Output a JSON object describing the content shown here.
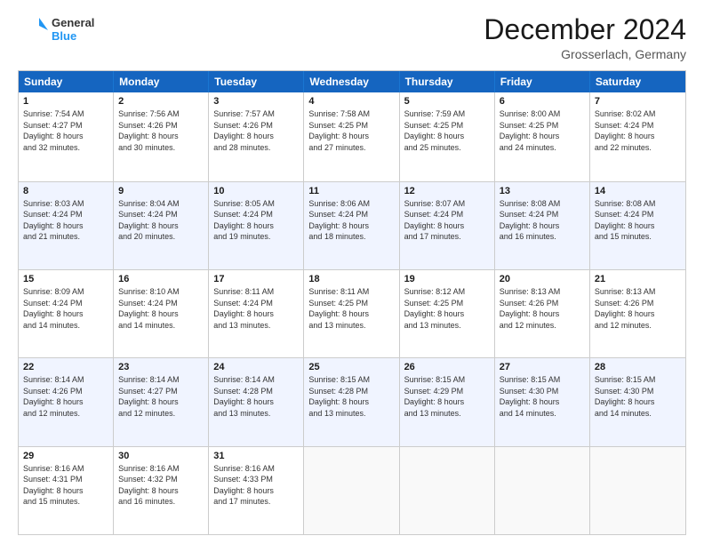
{
  "header": {
    "logo_general": "General",
    "logo_blue": "Blue",
    "month_title": "December 2024",
    "location": "Grosserlach, Germany"
  },
  "weekdays": [
    "Sunday",
    "Monday",
    "Tuesday",
    "Wednesday",
    "Thursday",
    "Friday",
    "Saturday"
  ],
  "rows": [
    [
      {
        "day": "1",
        "lines": [
          "Sunrise: 7:54 AM",
          "Sunset: 4:27 PM",
          "Daylight: 8 hours",
          "and 32 minutes."
        ]
      },
      {
        "day": "2",
        "lines": [
          "Sunrise: 7:56 AM",
          "Sunset: 4:26 PM",
          "Daylight: 8 hours",
          "and 30 minutes."
        ]
      },
      {
        "day": "3",
        "lines": [
          "Sunrise: 7:57 AM",
          "Sunset: 4:26 PM",
          "Daylight: 8 hours",
          "and 28 minutes."
        ]
      },
      {
        "day": "4",
        "lines": [
          "Sunrise: 7:58 AM",
          "Sunset: 4:25 PM",
          "Daylight: 8 hours",
          "and 27 minutes."
        ]
      },
      {
        "day": "5",
        "lines": [
          "Sunrise: 7:59 AM",
          "Sunset: 4:25 PM",
          "Daylight: 8 hours",
          "and 25 minutes."
        ]
      },
      {
        "day": "6",
        "lines": [
          "Sunrise: 8:00 AM",
          "Sunset: 4:25 PM",
          "Daylight: 8 hours",
          "and 24 minutes."
        ]
      },
      {
        "day": "7",
        "lines": [
          "Sunrise: 8:02 AM",
          "Sunset: 4:24 PM",
          "Daylight: 8 hours",
          "and 22 minutes."
        ]
      }
    ],
    [
      {
        "day": "8",
        "lines": [
          "Sunrise: 8:03 AM",
          "Sunset: 4:24 PM",
          "Daylight: 8 hours",
          "and 21 minutes."
        ]
      },
      {
        "day": "9",
        "lines": [
          "Sunrise: 8:04 AM",
          "Sunset: 4:24 PM",
          "Daylight: 8 hours",
          "and 20 minutes."
        ]
      },
      {
        "day": "10",
        "lines": [
          "Sunrise: 8:05 AM",
          "Sunset: 4:24 PM",
          "Daylight: 8 hours",
          "and 19 minutes."
        ]
      },
      {
        "day": "11",
        "lines": [
          "Sunrise: 8:06 AM",
          "Sunset: 4:24 PM",
          "Daylight: 8 hours",
          "and 18 minutes."
        ]
      },
      {
        "day": "12",
        "lines": [
          "Sunrise: 8:07 AM",
          "Sunset: 4:24 PM",
          "Daylight: 8 hours",
          "and 17 minutes."
        ]
      },
      {
        "day": "13",
        "lines": [
          "Sunrise: 8:08 AM",
          "Sunset: 4:24 PM",
          "Daylight: 8 hours",
          "and 16 minutes."
        ]
      },
      {
        "day": "14",
        "lines": [
          "Sunrise: 8:08 AM",
          "Sunset: 4:24 PM",
          "Daylight: 8 hours",
          "and 15 minutes."
        ]
      }
    ],
    [
      {
        "day": "15",
        "lines": [
          "Sunrise: 8:09 AM",
          "Sunset: 4:24 PM",
          "Daylight: 8 hours",
          "and 14 minutes."
        ]
      },
      {
        "day": "16",
        "lines": [
          "Sunrise: 8:10 AM",
          "Sunset: 4:24 PM",
          "Daylight: 8 hours",
          "and 14 minutes."
        ]
      },
      {
        "day": "17",
        "lines": [
          "Sunrise: 8:11 AM",
          "Sunset: 4:24 PM",
          "Daylight: 8 hours",
          "and 13 minutes."
        ]
      },
      {
        "day": "18",
        "lines": [
          "Sunrise: 8:11 AM",
          "Sunset: 4:25 PM",
          "Daylight: 8 hours",
          "and 13 minutes."
        ]
      },
      {
        "day": "19",
        "lines": [
          "Sunrise: 8:12 AM",
          "Sunset: 4:25 PM",
          "Daylight: 8 hours",
          "and 13 minutes."
        ]
      },
      {
        "day": "20",
        "lines": [
          "Sunrise: 8:13 AM",
          "Sunset: 4:26 PM",
          "Daylight: 8 hours",
          "and 12 minutes."
        ]
      },
      {
        "day": "21",
        "lines": [
          "Sunrise: 8:13 AM",
          "Sunset: 4:26 PM",
          "Daylight: 8 hours",
          "and 12 minutes."
        ]
      }
    ],
    [
      {
        "day": "22",
        "lines": [
          "Sunrise: 8:14 AM",
          "Sunset: 4:26 PM",
          "Daylight: 8 hours",
          "and 12 minutes."
        ]
      },
      {
        "day": "23",
        "lines": [
          "Sunrise: 8:14 AM",
          "Sunset: 4:27 PM",
          "Daylight: 8 hours",
          "and 12 minutes."
        ]
      },
      {
        "day": "24",
        "lines": [
          "Sunrise: 8:14 AM",
          "Sunset: 4:28 PM",
          "Daylight: 8 hours",
          "and 13 minutes."
        ]
      },
      {
        "day": "25",
        "lines": [
          "Sunrise: 8:15 AM",
          "Sunset: 4:28 PM",
          "Daylight: 8 hours",
          "and 13 minutes."
        ]
      },
      {
        "day": "26",
        "lines": [
          "Sunrise: 8:15 AM",
          "Sunset: 4:29 PM",
          "Daylight: 8 hours",
          "and 13 minutes."
        ]
      },
      {
        "day": "27",
        "lines": [
          "Sunrise: 8:15 AM",
          "Sunset: 4:30 PM",
          "Daylight: 8 hours",
          "and 14 minutes."
        ]
      },
      {
        "day": "28",
        "lines": [
          "Sunrise: 8:15 AM",
          "Sunset: 4:30 PM",
          "Daylight: 8 hours",
          "and 14 minutes."
        ]
      }
    ],
    [
      {
        "day": "29",
        "lines": [
          "Sunrise: 8:16 AM",
          "Sunset: 4:31 PM",
          "Daylight: 8 hours",
          "and 15 minutes."
        ]
      },
      {
        "day": "30",
        "lines": [
          "Sunrise: 8:16 AM",
          "Sunset: 4:32 PM",
          "Daylight: 8 hours",
          "and 16 minutes."
        ]
      },
      {
        "day": "31",
        "lines": [
          "Sunrise: 8:16 AM",
          "Sunset: 4:33 PM",
          "Daylight: 8 hours",
          "and 17 minutes."
        ]
      },
      {
        "day": "",
        "lines": []
      },
      {
        "day": "",
        "lines": []
      },
      {
        "day": "",
        "lines": []
      },
      {
        "day": "",
        "lines": []
      }
    ]
  ]
}
